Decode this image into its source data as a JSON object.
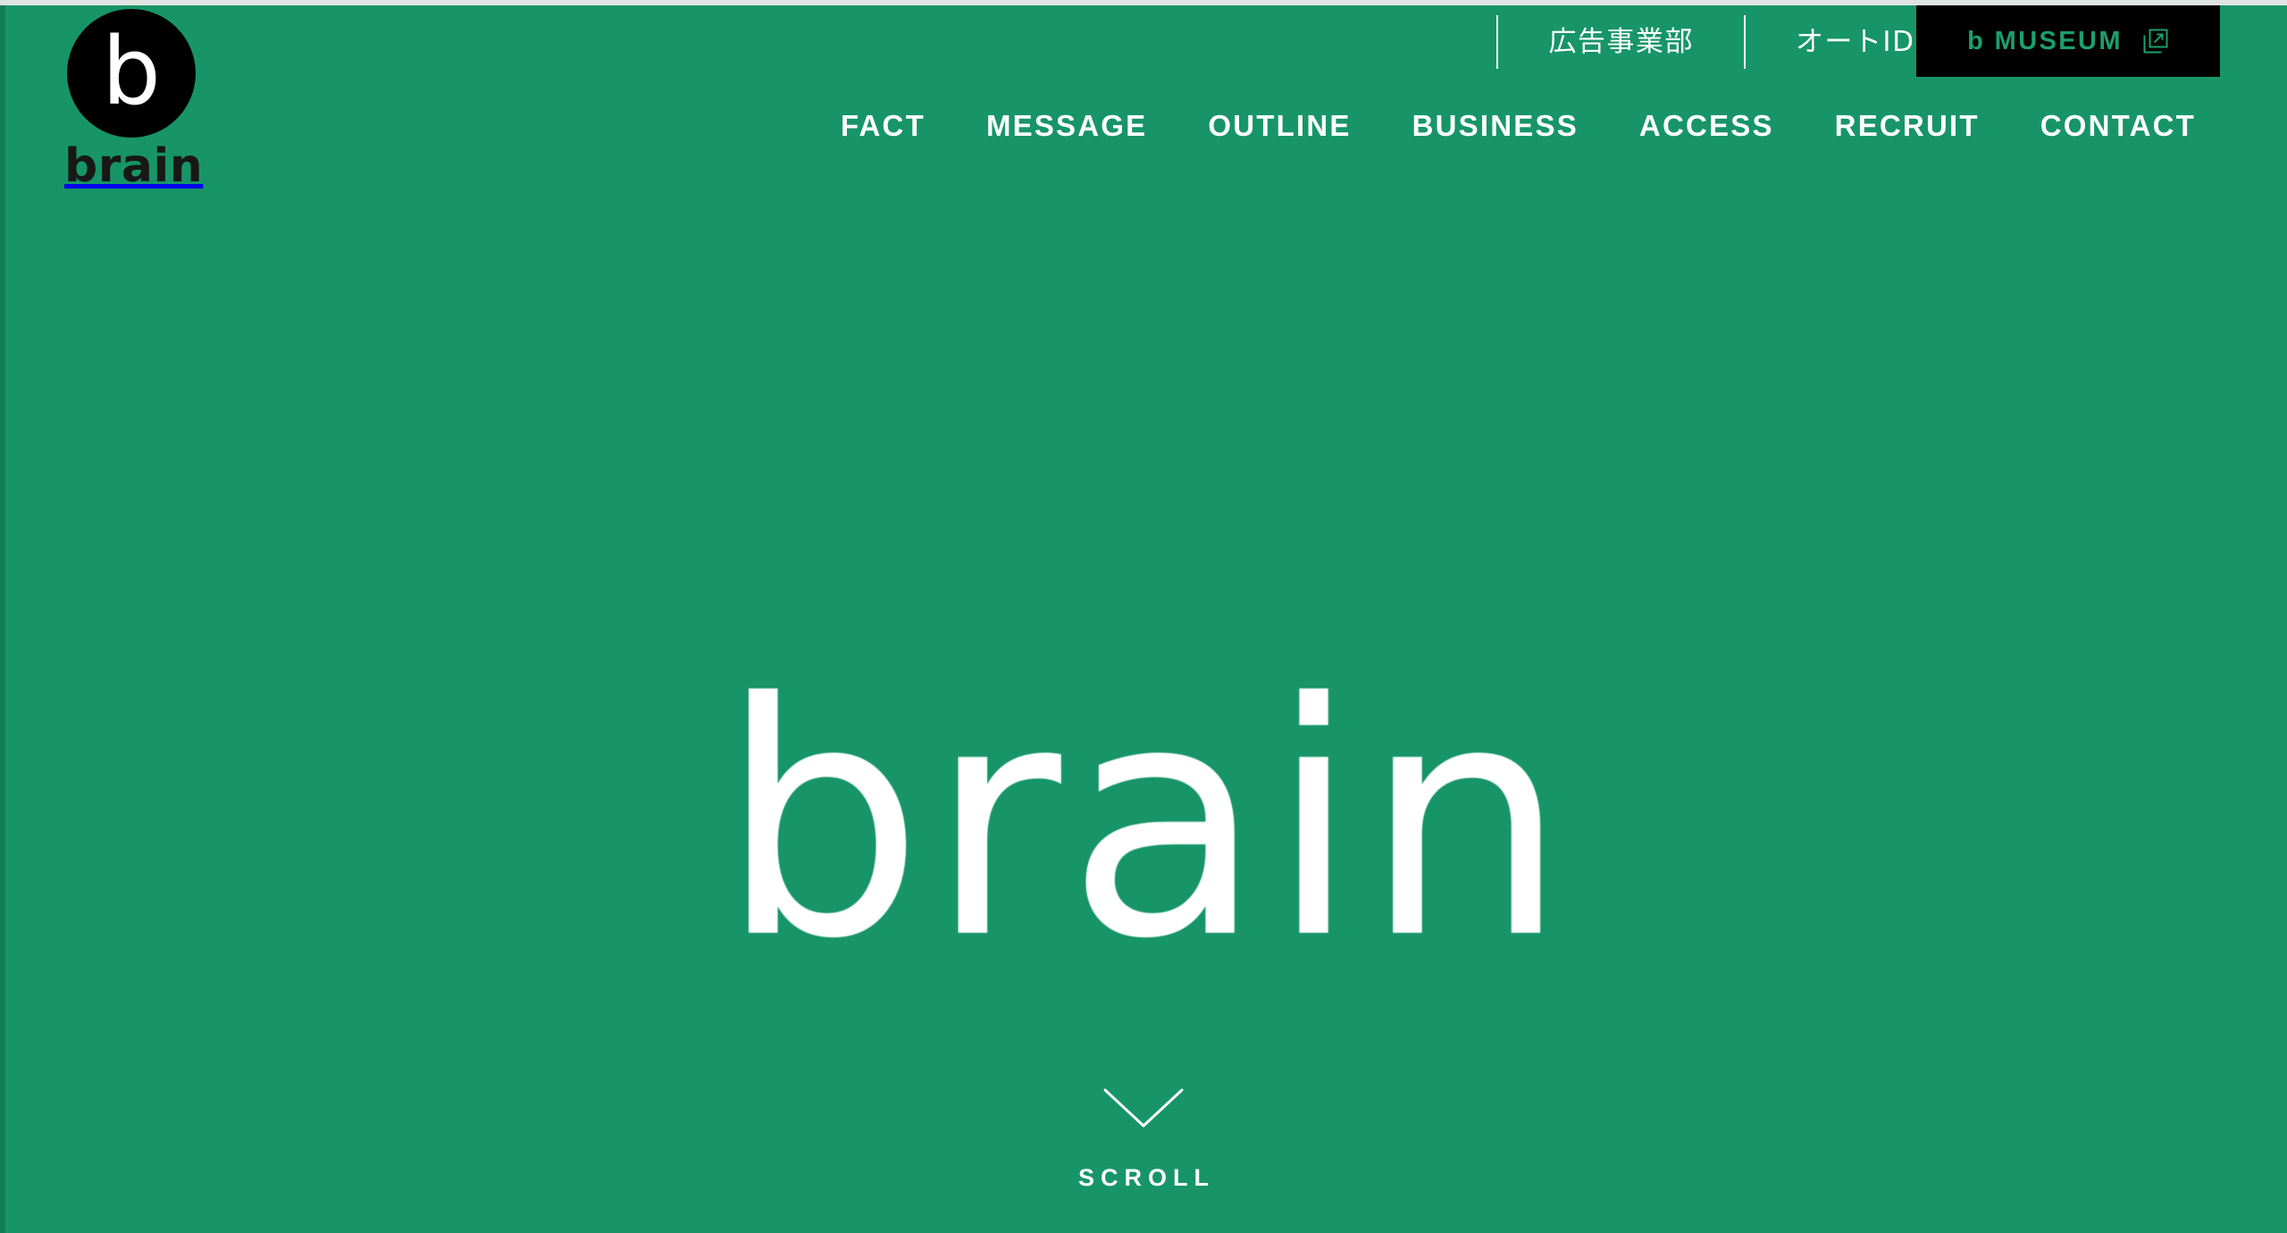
{
  "theme": {
    "brand_green": "#179568",
    "brand_green_dark": "#0f7f57",
    "black": "#000000",
    "white": "#ffffff",
    "museum_text_green": "#1d9e6e",
    "logo_text_dark": "#181818",
    "top_edge_strip": "#dfe3e2"
  },
  "logo": {
    "mark_letter": "b",
    "wordmark": "brain"
  },
  "utility_bar": {
    "links": [
      {
        "label": "広告事業部",
        "has_external_icon": false,
        "icon": ""
      },
      {
        "label": "オートID・モバイル事業部",
        "has_external_icon": true,
        "icon": "external-link-icon"
      }
    ],
    "museum_button": {
      "label": "b MUSEUM",
      "icon": "external-link-icon"
    }
  },
  "main_nav": {
    "items": [
      {
        "label": "FACT"
      },
      {
        "label": "MESSAGE"
      },
      {
        "label": "OUTLINE"
      },
      {
        "label": "BUSINESS"
      },
      {
        "label": "ACCESS"
      },
      {
        "label": "RECRUIT"
      },
      {
        "label": "CONTACT"
      }
    ]
  },
  "hero": {
    "wordmark": "brain"
  },
  "scroll": {
    "label": "SCROLL",
    "icon": "chevron-down-icon"
  }
}
